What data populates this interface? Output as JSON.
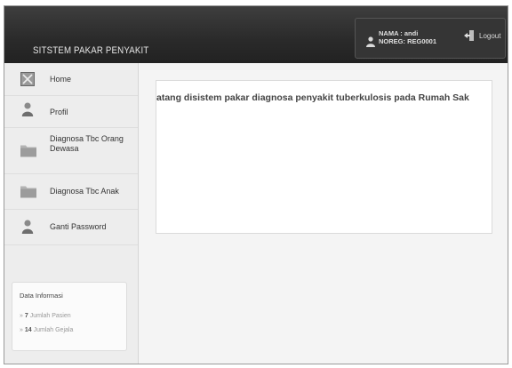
{
  "header": {
    "brand": "SITSTEM PAKAR PENYAKIT",
    "user_name": "NAMA : andi",
    "user_noreg": "NOREG: REG0001",
    "logout_label": "Logout"
  },
  "sidebar": {
    "items": [
      {
        "label": "Home",
        "icon": "home-icon"
      },
      {
        "label": "Profil",
        "icon": "user-icon"
      },
      {
        "label": "Diagnosa Tbc Orang Dewasa",
        "icon": "folder-icon"
      },
      {
        "label": "Diagnosa Tbc Anak",
        "icon": "folder-icon"
      },
      {
        "label": "Ganti Password",
        "icon": "user-icon"
      }
    ],
    "info": {
      "title": "Data Informasi",
      "pasien_count": "7",
      "pasien_label": "Jumlah Pasien",
      "gejala_count": "14",
      "gejala_label": "Jumlah Gejala"
    }
  },
  "main": {
    "welcome_text": "atang disistem pakar diagnosa penyakit tuberkulosis pada Rumah Sak"
  },
  "colors": {
    "header_bg": "#2e2e2e",
    "sidebar_bg": "#ededed",
    "content_bg": "#ffffff"
  }
}
